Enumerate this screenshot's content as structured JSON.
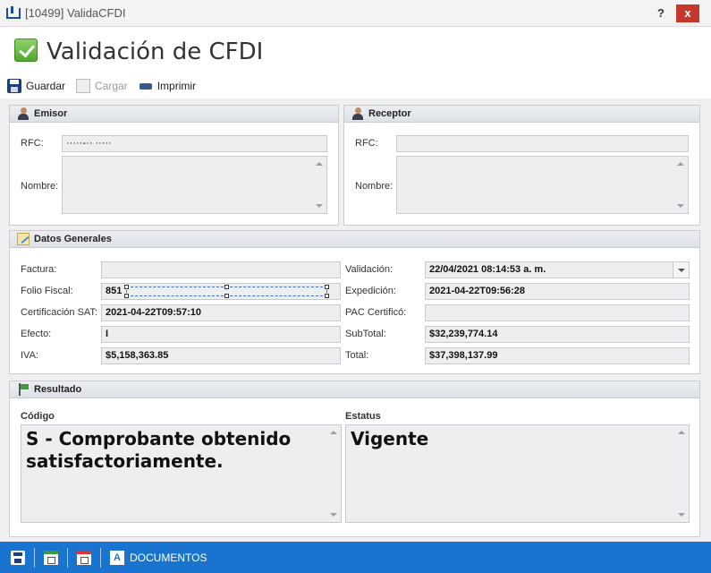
{
  "window": {
    "title": "[10499] ValidaCFDI",
    "help_glyph": "?",
    "close_glyph": "x"
  },
  "header": {
    "title": "Validación de CFDI",
    "toolbar": {
      "save_label": "Guardar",
      "load_label": "Cargar",
      "print_label": "Imprimir"
    }
  },
  "emisor": {
    "title": "Emisor",
    "rfc_label": "RFC:",
    "rfc_value": "·····-·· ·····",
    "nombre_label": "Nombre:",
    "nombre_value": ""
  },
  "receptor": {
    "title": "Receptor",
    "rfc_label": "RFC:",
    "rfc_value": "",
    "nombre_label": "Nombre:",
    "nombre_value": ""
  },
  "datos_generales": {
    "title": "Datos Generales",
    "factura_label": "Factura:",
    "factura_value": "",
    "folio_label": "Folio Fiscal:",
    "folio_value": "851",
    "cert_sat_label": "Certificación SAT:",
    "cert_sat_value": "2021-04-22T09:57:10",
    "efecto_label": "Efecto:",
    "efecto_value": "I",
    "iva_label": "IVA:",
    "iva_value": "$5,158,363.85",
    "validacion_label": "Validación:",
    "validacion_value": "22/04/2021 08:14:53 a. m.",
    "expedicion_label": "Expedición:",
    "expedicion_value": "2021-04-22T09:56:28",
    "pac_label": "PAC Certificó:",
    "pac_value": "",
    "subtotal_label": "SubTotal:",
    "subtotal_value": "$32,239,774.14",
    "total_label": "Total:",
    "total_value": "$37,398,137.99"
  },
  "resultado": {
    "title": "Resultado",
    "codigo_label": "Código",
    "codigo_value": "S - Comprobante obtenido satisfactoriamente.",
    "estatus_label": "Estatus",
    "estatus_value": "Vigente"
  },
  "statusbar": {
    "documents_icon_letter": "A",
    "documents_label": "DOCUMENTOS"
  },
  "colors": {
    "statusbar": "#1874cf",
    "close_button": "#c8372d",
    "field_bg": "#eceef0"
  }
}
